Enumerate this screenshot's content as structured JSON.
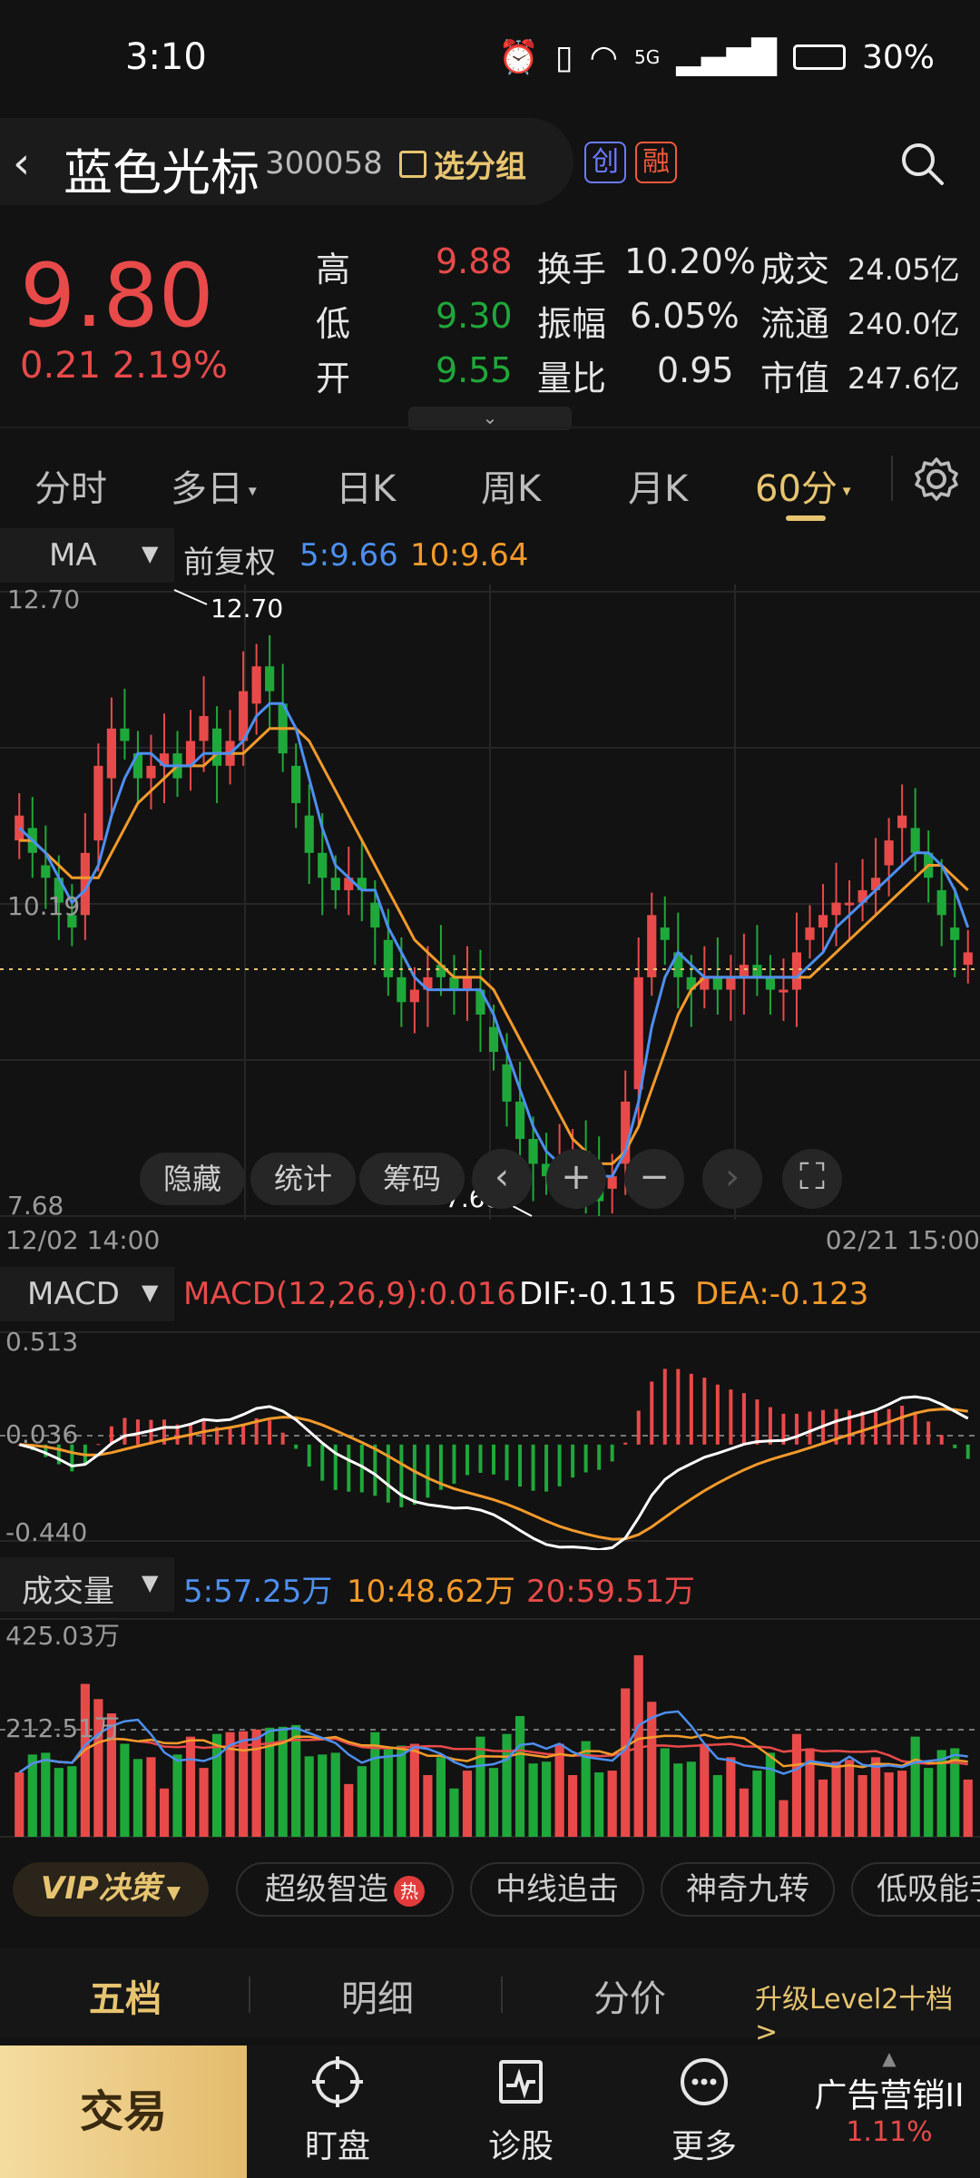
{
  "status": {
    "time": "3:10",
    "network": "5G",
    "battery": "30%"
  },
  "header": {
    "stock_name": "蓝色光标",
    "stock_code": "300058",
    "group_label": "选分组",
    "badge_chuang": "创",
    "badge_rong": "融"
  },
  "quote": {
    "price": "9.80",
    "change": "0.21 2.19%",
    "high_label": "高",
    "high": "9.88",
    "low_label": "低",
    "low": "9.30",
    "open_label": "开",
    "open": "9.55",
    "turnover_label": "换手",
    "turnover": "10.20%",
    "amplitude_label": "振幅",
    "amplitude": "6.05%",
    "volratio_label": "量比",
    "volratio": "0.95",
    "deal_label": "成交",
    "deal": "24.05亿",
    "float_label": "流通",
    "float": "240.0亿",
    "mktcap_label": "市值",
    "mktcap": "247.6亿"
  },
  "tabs": {
    "t1": "分时",
    "t2": "多日",
    "t3": "日K",
    "t4": "周K",
    "t5": "月K",
    "t6": "60分"
  },
  "ma_legend": {
    "indicator": "MA",
    "adjust": "前复权",
    "ma5": "5:9.66",
    "ma10": "10:9.64"
  },
  "chart_labels": {
    "y_top": "12.70",
    "y_mid": "10.19",
    "y_bottom": "7.68",
    "high_mark": "12.70",
    "low_mark": "7.68",
    "x_start": "12/02 14:00",
    "x_end": "02/21 15:00"
  },
  "chart_buttons": {
    "hide": "隐藏",
    "stats": "统计",
    "chips": "筹码"
  },
  "macd_legend": {
    "indicator": "MACD",
    "macd": "MACD(12,26,9):0.016",
    "dif": "DIF:-0.115",
    "dea": "DEA:-0.123",
    "y_top": "0.513",
    "y_mid": "0.036",
    "y_bottom": "-0.440"
  },
  "vol_legend": {
    "indicator": "成交量",
    "v5": "5:57.25万",
    "v10": "10:48.62万",
    "v20": "20:59.51万",
    "y_top": "425.03万",
    "y_mid": "212.51万"
  },
  "strategy": {
    "vip": "VIP决策",
    "p1": "超级智造",
    "hot": "热",
    "p2": "中线追击",
    "p3": "神奇九转",
    "p4": "低吸能手"
  },
  "book": {
    "b1": "五档",
    "b2": "明细",
    "b3": "分价",
    "upgrade": "升级Level2十档 >"
  },
  "nav": {
    "trade": "交易",
    "watch": "盯盘",
    "diagnose": "诊股",
    "more": "更多",
    "ad_title": "广告营销II",
    "ad_change": "1.11%"
  },
  "colors": {
    "up": "#e84a4a",
    "down": "#1fa83a",
    "ma5": "#4d8ff0",
    "ma10": "#f39a2b",
    "accent": "#e7c470"
  },
  "chart_data": {
    "type": "candlestick",
    "ylim": [
      7.68,
      12.7
    ],
    "close": [
      10.9,
      10.6,
      10.4,
      10.2,
      10.0,
      10.6,
      11.3,
      11.6,
      11.5,
      11.2,
      11.3,
      11.4,
      11.2,
      11.5,
      11.7,
      11.3,
      11.5,
      11.9,
      12.1,
      11.9,
      11.4,
      11.0,
      10.6,
      10.4,
      10.3,
      10.4,
      10.3,
      10.0,
      9.6,
      9.4,
      9.5,
      9.6,
      9.6,
      9.5,
      9.6,
      9.3,
      9.0,
      8.6,
      8.3,
      8.1,
      8.0,
      8.1,
      8.2,
      8.0,
      7.8,
      8.0,
      8.6,
      9.6,
      10.1,
      9.9,
      9.6,
      9.5,
      9.6,
      9.5,
      9.6,
      9.7,
      9.6,
      9.5,
      9.5,
      9.8,
      10.0,
      10.1,
      10.2,
      10.2,
      10.3,
      10.4,
      10.7,
      10.9,
      10.6,
      10.4,
      10.1,
      9.9,
      9.8
    ],
    "open": [
      10.7,
      10.8,
      10.5,
      10.4,
      10.1,
      10.1,
      10.7,
      11.2,
      11.6,
      11.4,
      11.2,
      11.3,
      11.4,
      11.3,
      11.5,
      11.6,
      11.3,
      11.5,
      11.8,
      12.1,
      11.8,
      11.3,
      10.9,
      10.6,
      10.4,
      10.3,
      10.4,
      10.2,
      9.9,
      9.6,
      9.4,
      9.5,
      9.7,
      9.6,
      9.5,
      9.5,
      9.2,
      8.9,
      8.6,
      8.3,
      8.1,
      8.0,
      8.1,
      8.2,
      8.0,
      7.9,
      8.1,
      8.7,
      9.6,
      10.0,
      9.8,
      9.6,
      9.5,
      9.6,
      9.5,
      9.6,
      9.7,
      9.6,
      9.5,
      9.5,
      9.9,
      10.0,
      10.1,
      10.2,
      10.2,
      10.3,
      10.5,
      10.8,
      10.8,
      10.6,
      10.3,
      10.0,
      9.7
    ],
    "ma5": [
      10.8,
      10.7,
      10.6,
      10.4,
      10.2,
      10.3,
      10.5,
      10.9,
      11.2,
      11.4,
      11.4,
      11.3,
      11.3,
      11.3,
      11.4,
      11.4,
      11.4,
      11.5,
      11.7,
      11.8,
      11.8,
      11.6,
      11.2,
      10.8,
      10.5,
      10.4,
      10.3,
      10.3,
      10.0,
      9.8,
      9.6,
      9.5,
      9.5,
      9.5,
      9.5,
      9.5,
      9.3,
      9.0,
      8.7,
      8.4,
      8.2,
      8.1,
      8.1,
      8.1,
      8.0,
      8.0,
      8.2,
      8.6,
      9.2,
      9.6,
      9.8,
      9.7,
      9.6,
      9.6,
      9.6,
      9.6,
      9.6,
      9.6,
      9.6,
      9.6,
      9.7,
      9.8,
      10.0,
      10.1,
      10.2,
      10.3,
      10.4,
      10.5,
      10.6,
      10.6,
      10.5,
      10.3,
      10.0
    ],
    "ma10": [
      10.7,
      10.7,
      10.6,
      10.5,
      10.4,
      10.4,
      10.4,
      10.6,
      10.8,
      11.0,
      11.1,
      11.2,
      11.3,
      11.3,
      11.3,
      11.4,
      11.4,
      11.4,
      11.5,
      11.6,
      11.6,
      11.6,
      11.5,
      11.3,
      11.1,
      10.9,
      10.7,
      10.5,
      10.3,
      10.1,
      9.9,
      9.8,
      9.7,
      9.6,
      9.6,
      9.6,
      9.5,
      9.3,
      9.1,
      8.9,
      8.7,
      8.5,
      8.3,
      8.2,
      8.1,
      8.1,
      8.2,
      8.4,
      8.7,
      9.0,
      9.3,
      9.5,
      9.6,
      9.6,
      9.6,
      9.6,
      9.6,
      9.6,
      9.6,
      9.6,
      9.6,
      9.7,
      9.8,
      9.9,
      10.0,
      10.1,
      10.2,
      10.3,
      10.4,
      10.5,
      10.5,
      10.4,
      10.3
    ]
  }
}
